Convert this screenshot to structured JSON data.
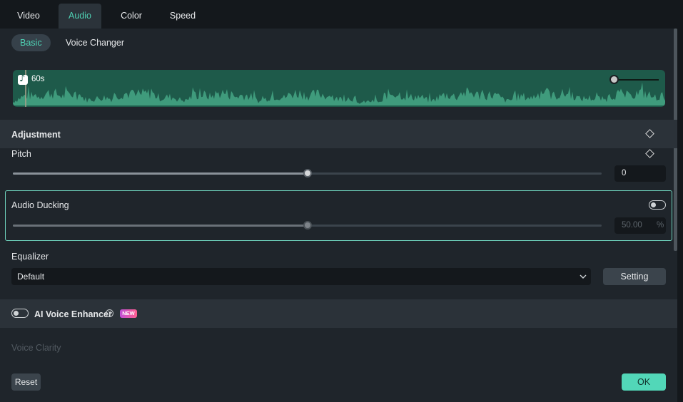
{
  "tabs": [
    {
      "label": "Video",
      "active": false
    },
    {
      "label": "Audio",
      "active": true
    },
    {
      "label": "Color",
      "active": false
    },
    {
      "label": "Speed",
      "active": false
    }
  ],
  "subtabs": [
    {
      "label": "Basic",
      "active": true
    },
    {
      "label": "Voice Changer",
      "active": false
    }
  ],
  "waveform": {
    "duration_label": "60s",
    "icon": "music-note-icon",
    "color": "#3f9b7c",
    "background": "#1e5a4a"
  },
  "adjustment": {
    "title": "Adjustment",
    "pitch": {
      "label": "Pitch",
      "value": "0",
      "fraction": 0.5
    }
  },
  "audio_ducking": {
    "label": "Audio Ducking",
    "enabled": false,
    "value": "50.00",
    "unit": "%",
    "fraction": 0.5
  },
  "equalizer": {
    "label": "Equalizer",
    "selected": "Default",
    "setting_label": "Setting"
  },
  "ai_voice_enhancer": {
    "label": "AI Voice Enhancer",
    "badge": "NEW",
    "enabled": false
  },
  "voice_clarity": {
    "label": "Voice Clarity"
  },
  "footer": {
    "reset_label": "Reset",
    "ok_label": "OK"
  },
  "colors": {
    "accent": "#4fd1b4",
    "ok_button": "#52d7b8",
    "ducking_border": "#6fd3bd"
  }
}
